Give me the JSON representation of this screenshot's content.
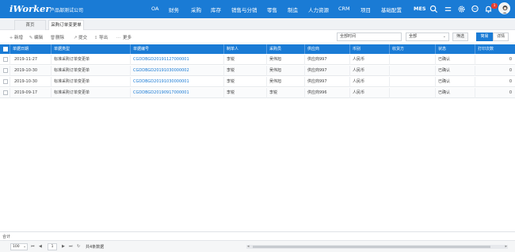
{
  "app": {
    "logo": "iWorker",
    "company": "产品部测试公司"
  },
  "nav": {
    "items": [
      "OA",
      "财务",
      "采购",
      "库存",
      "销售与分销",
      "零售",
      "制造",
      "人力资源",
      "CRM",
      "项目",
      "基础配置",
      "MES"
    ],
    "notification_count": "1"
  },
  "tabs": [
    "首页",
    "采购订单变更单"
  ],
  "toolbar": {
    "buttons": [
      "新增",
      "编辑",
      "删除",
      "提交",
      "导出",
      "更多"
    ],
    "search_value": "全部时间",
    "select_value": "全部",
    "filter_label": "筛选",
    "simple_label": "简易",
    "detail_label": "详情"
  },
  "table": {
    "columns": [
      "单据日期",
      "单据类型",
      "单据编号",
      "制单人",
      "采购员",
      "供应商",
      "币别",
      "收货方",
      "状态",
      "打印次数"
    ],
    "rows": [
      [
        "2019-11-27",
        "标准采购订单变更单",
        "CGDDBGD20191127000001",
        "李锐",
        "吴伟旭",
        "供应商997",
        "人民币",
        "",
        "已确认",
        "0"
      ],
      [
        "2019-10-30",
        "标准采购订单变更单",
        "CGDDBGD20191030000002",
        "李锐",
        "吴伟旭",
        "供应商997",
        "人民币",
        "",
        "已确认",
        "0"
      ],
      [
        "2019-10-30",
        "标准采购订单变更单",
        "CGDDBGD20191030000001",
        "李锐",
        "吴伟旭",
        "供应商997",
        "人民币",
        "",
        "已确认",
        "0"
      ],
      [
        "2019-09-17",
        "标准采购订单变更单",
        "CGDDBGD20190917000001",
        "李锐",
        "李锐",
        "供应商996",
        "人民币",
        "",
        "已确认",
        "0"
      ]
    ]
  },
  "footer": {
    "summary_label": "合计",
    "page_size": "100",
    "page_number": "1",
    "total_text": "共4条数据"
  },
  "colors": {
    "primary": "#1a7bd5",
    "badge": "#e63c2f"
  }
}
